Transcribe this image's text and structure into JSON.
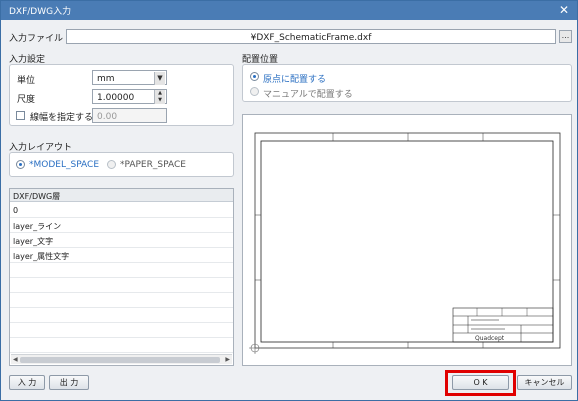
{
  "window": {
    "title": "DXF/DWG入力",
    "close_glyph": "✕"
  },
  "input_file": {
    "label": "入力ファイル",
    "path": "¥DXF_SchematicFrame.dxf",
    "browse_label": "..."
  },
  "input_settings": {
    "heading": "入力設定",
    "unit": {
      "label": "単位",
      "value": "mm"
    },
    "scale": {
      "label": "尺度",
      "value": "1.00000"
    },
    "line_width": {
      "label": "線幅を指定する",
      "value": "0.00",
      "checked": false
    }
  },
  "input_layout": {
    "heading": "入力レイアウト",
    "options": [
      {
        "label": "*MODEL_SPACE",
        "selected": true
      },
      {
        "label": "*PAPER_SPACE",
        "selected": false
      }
    ]
  },
  "layers": {
    "header": "DXF/DWG層",
    "rows": [
      "0",
      "layer_ライン",
      "layer_文字",
      "layer_属性文字"
    ]
  },
  "placement": {
    "heading": "配置位置",
    "options": [
      {
        "label": "原点に配置する",
        "selected": true
      },
      {
        "label": "マニュアルで配置する",
        "selected": false
      }
    ]
  },
  "preview": {
    "brand": "Quadcept"
  },
  "buttons": {
    "input": "入 力",
    "output": "出 力",
    "ok": "O K",
    "cancel": "キャンセル"
  },
  "colors": {
    "titlebar": "#4a7cb5",
    "accent": "#2a6fc2",
    "highlight": "#e00000"
  }
}
